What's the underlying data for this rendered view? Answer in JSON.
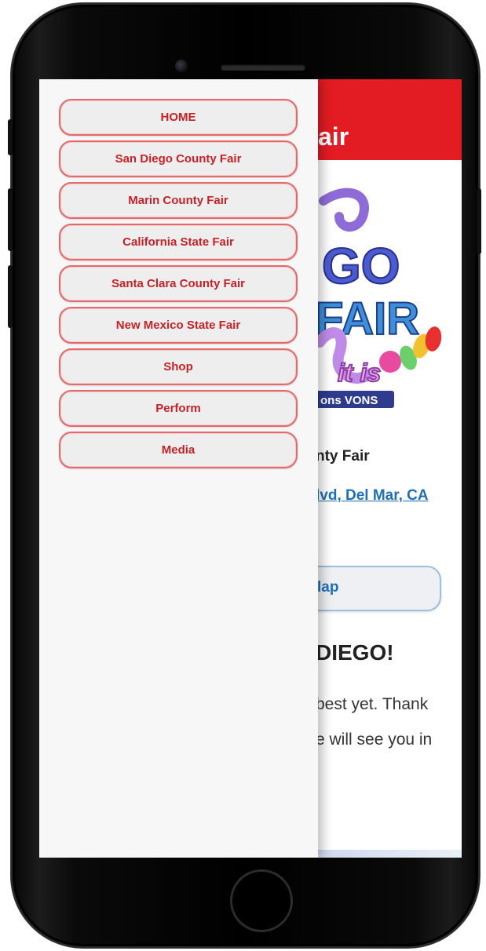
{
  "page": {
    "title": "air",
    "fair_name": "nty Fair",
    "address": "lvd, Del Mar, CA",
    "map_button_label": "lap",
    "headline": "DIEGO!",
    "body_lines": [
      " best yet. Thank",
      "e will see you in"
    ],
    "logo_text": {
      "line1": "GO",
      "line2": "FAIR",
      "script": "it is",
      "sponsor": "ons VONS"
    },
    "header_color": "#e31b23",
    "link_color": "#1f6fb5"
  },
  "menu": {
    "items": [
      {
        "label": "HOME"
      },
      {
        "label": "San Diego County Fair"
      },
      {
        "label": "Marin County Fair"
      },
      {
        "label": "California State Fair"
      },
      {
        "label": "Santa Clara County Fair"
      },
      {
        "label": "New Mexico State Fair"
      },
      {
        "label": "Shop"
      },
      {
        "label": "Perform"
      },
      {
        "label": "Media"
      }
    ],
    "accent_color": "#c62127"
  }
}
